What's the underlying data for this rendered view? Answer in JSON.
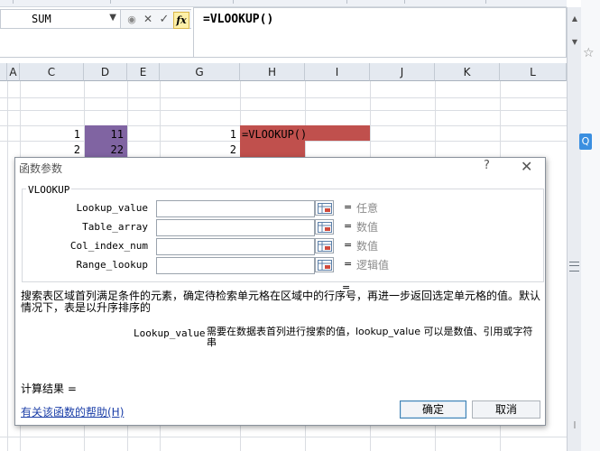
{
  "namebox": {
    "value": "SUM",
    "dropdown_icon": "chevron-down-icon"
  },
  "formula_bar": {
    "cancel_symbol": "✕",
    "enter_symbol": "✓",
    "fx_label": "fx",
    "formula": "=VLOOKUP()"
  },
  "columns": [
    "A",
    "C",
    "D",
    "E",
    "G",
    "H",
    "I",
    "J",
    "K",
    "L"
  ],
  "cells": {
    "c_row1": "1",
    "c_row2": "2",
    "d_row1": "11",
    "d_row2": "22",
    "g_row1": "1",
    "g_row2": "2",
    "h_row1": "=VLOOKUP()"
  },
  "colors": {
    "purple_fill": "#8064a2",
    "red_fill": "#c0504d",
    "ok_border": "#3c7fb1",
    "link": "#1c3fa8"
  },
  "dialog": {
    "title": "函数参数",
    "help_symbol": "?",
    "close_symbol": "✕",
    "function_name": "VLOOKUP",
    "args": [
      {
        "label": "Lookup_value",
        "result": "任意"
      },
      {
        "label": "Table_array",
        "result": "数值"
      },
      {
        "label": "Col_index_num",
        "result": "数值"
      },
      {
        "label": "Range_lookup",
        "result": "逻辑值"
      }
    ],
    "eq": "=",
    "description": "搜索表区域首列满足条件的元素，确定待检索单元格在区域中的行序号，再进一步返回选定单元格的值。默认情况下，表是以升序排序的",
    "param_name": "Lookup_value",
    "param_desc": "需要在数据表首列进行搜索的值，lookup_value 可以是数值、引用或字符串",
    "calc_result": "计算结果 =",
    "help_link": "有关该函数的帮助(H)",
    "ok": "确定",
    "cancel": "取消"
  }
}
